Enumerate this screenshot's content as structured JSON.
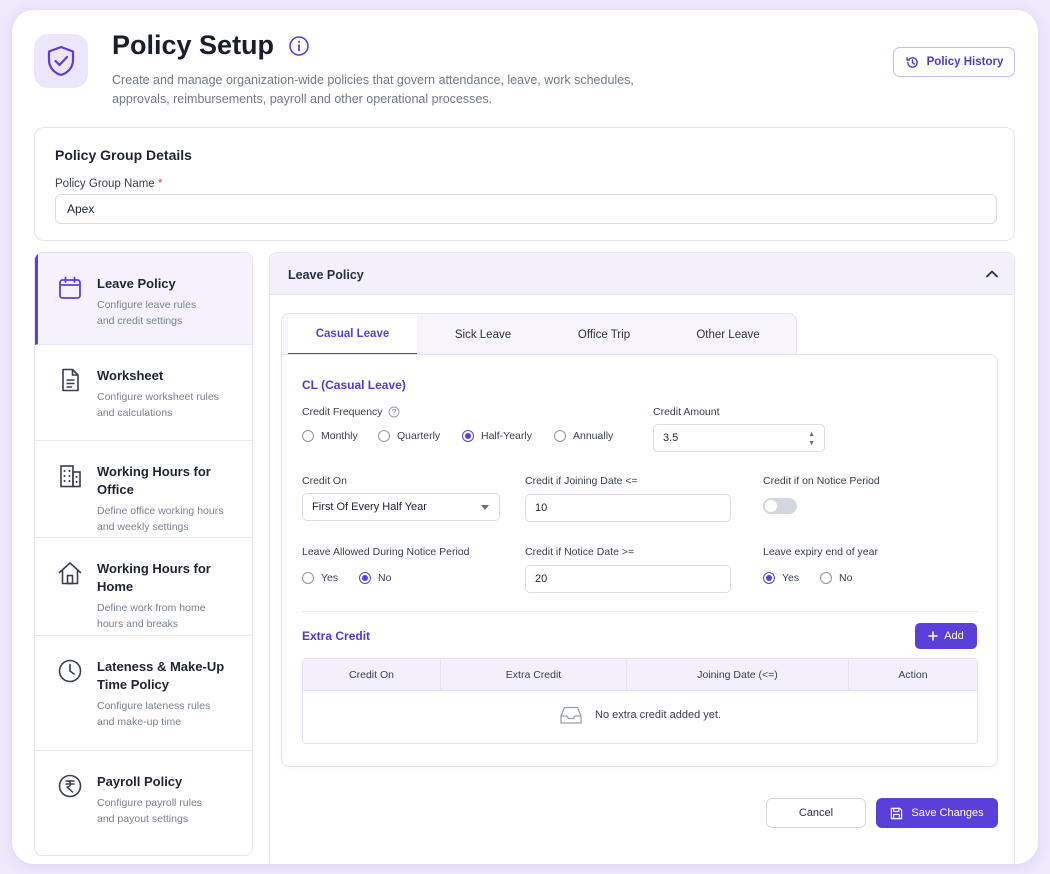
{
  "header": {
    "title": "Policy Setup",
    "subtitle": "Create and manage organization-wide policies that govern attendance, leave, work schedules, approvals, reimbursements, payroll and other operational processes.",
    "history_button": "Policy History",
    "icon": "shield-check-icon"
  },
  "group": {
    "title": "Policy Group Details",
    "name_label": "Policy Group Name",
    "required_mark": "*",
    "name_value": "Apex"
  },
  "sidebar": {
    "items": [
      {
        "title": "Leave Policy",
        "desc1": "Configure leave rules",
        "desc2": "and credit settings",
        "icon": "calendar-icon",
        "active": true
      },
      {
        "title": "Worksheet",
        "desc1": "Configure worksheet rules",
        "desc2": "and calculations",
        "icon": "document-icon",
        "active": false
      },
      {
        "title": "Working Hours for Office",
        "desc1": "Define office working hours",
        "desc2": "and weekly settings",
        "icon": "building-icon",
        "active": false
      },
      {
        "title": "Working Hours for Home",
        "desc1": "Define work from home",
        "desc2": "hours and breaks",
        "icon": "home-icon",
        "active": false
      },
      {
        "title": "Lateness & Make-Up",
        "title2": "Time Policy",
        "desc1": "Configure lateness rules",
        "desc2": "and make-up time",
        "icon": "clock-icon",
        "active": false
      },
      {
        "title": "Payroll Policy",
        "desc1": "Configure payroll rules",
        "desc2": "and payout settings",
        "icon": "rupee-icon",
        "active": false
      }
    ]
  },
  "panel": {
    "title": "Leave Policy",
    "tabs": [
      "Casual Leave",
      "Sick Leave",
      "Office Trip",
      "Other Leave"
    ],
    "active_tab": "Casual Leave"
  },
  "form": {
    "section_title": "CL (Casual Leave)",
    "credit_frequency_label": "Credit Frequency",
    "credit_frequency_options": [
      "Monthly",
      "Quarterly",
      "Half-Yearly",
      "Annually"
    ],
    "credit_frequency_selected": "Half-Yearly",
    "credit_amount_label": "Credit Amount",
    "credit_amount_value": "3.5",
    "credit_on_label": "Credit On",
    "credit_on_value": "First Of Every Half Year",
    "joining_date_label": "Credit if Joining Date <=",
    "joining_date_value": "10",
    "notice_period_label": "Credit if on Notice Period",
    "notice_period_toggle": false,
    "leave_notice_label": "Leave Allowed During Notice Period",
    "leave_notice_options": [
      "Yes",
      "No"
    ],
    "leave_notice_selected": "No",
    "notice_date_label": "Credit if Notice Date >=",
    "notice_date_value": "20",
    "expiry_label": "Leave expiry end of year",
    "expiry_options": [
      "Yes",
      "No"
    ],
    "expiry_selected": "Yes"
  },
  "extra_credit": {
    "title": "Extra Credit",
    "add_button": "Add",
    "columns": [
      "Credit On",
      "Extra Credit",
      "Joining Date (<=)",
      "Action"
    ],
    "empty_text": "No extra credit added yet."
  },
  "actions": {
    "cancel": "Cancel",
    "save": "Save Changes"
  },
  "colors": {
    "accent": "#5b3fd9",
    "background": "#efe9fb"
  }
}
